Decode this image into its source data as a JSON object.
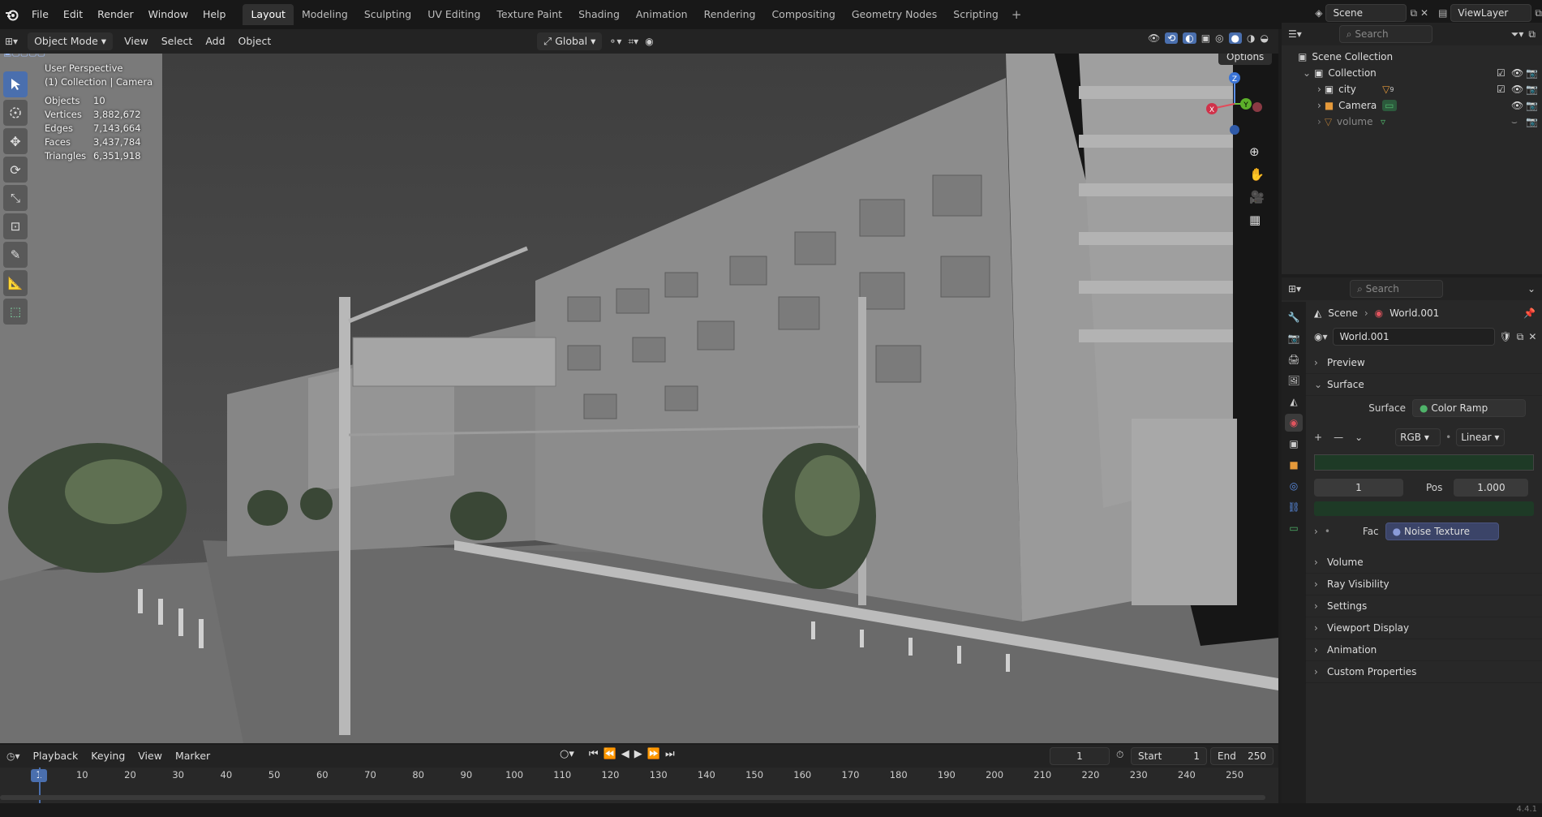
{
  "topbar": {
    "menus": [
      "File",
      "Edit",
      "Render",
      "Window",
      "Help"
    ],
    "workspaces": [
      "Layout",
      "Modeling",
      "Sculpting",
      "UV Editing",
      "Texture Paint",
      "Shading",
      "Animation",
      "Rendering",
      "Compositing",
      "Geometry Nodes",
      "Scripting"
    ],
    "active_workspace": "Layout",
    "scene": "Scene",
    "view_layer": "ViewLayer"
  },
  "viewport_header": {
    "mode": "Object Mode",
    "menus": [
      "View",
      "Select",
      "Add",
      "Object"
    ],
    "transform_orientation": "Global",
    "options": "Options"
  },
  "viewport": {
    "perspective": "User Perspective",
    "collection_info": "(1) Collection | Camera",
    "stats": [
      {
        "label": "Objects",
        "value": "10"
      },
      {
        "label": "Vertices",
        "value": "3,882,672"
      },
      {
        "label": "Edges",
        "value": "7,143,664"
      },
      {
        "label": "Faces",
        "value": "3,437,784"
      },
      {
        "label": "Triangles",
        "value": "6,351,918"
      }
    ],
    "gizmo": {
      "x": "X",
      "y": "Y",
      "z": "Z"
    }
  },
  "outliner": {
    "search_placeholder": "Search",
    "root": "Scene Collection",
    "items": [
      {
        "name": "Collection",
        "level": 0
      },
      {
        "name": "city",
        "level": 1
      },
      {
        "name": "Camera",
        "level": 1
      },
      {
        "name": "volume",
        "level": 1
      }
    ],
    "city_badge": "9"
  },
  "properties": {
    "search_placeholder": "Search",
    "breadcrumb": [
      "Scene",
      "World.001"
    ],
    "world_name": "World.001",
    "panels_top": [
      "Preview",
      "Surface"
    ],
    "surface_label": "Surface",
    "surface_value": "Color Ramp",
    "ramp_color_mode": "RGB",
    "ramp_interp": "Linear",
    "stop_index": "1",
    "pos_label": "Pos",
    "pos_value": "1.000",
    "fac_label": "Fac",
    "fac_value": "Noise Texture",
    "panels_bottom": [
      "Volume",
      "Ray Visibility",
      "Settings",
      "Viewport Display",
      "Animation",
      "Custom Properties"
    ]
  },
  "timeline": {
    "menus": [
      "Playback",
      "Keying",
      "View",
      "Marker"
    ],
    "current_frame": "1",
    "start_label": "Start",
    "start": "1",
    "end_label": "End",
    "end": "250",
    "ticks": [
      "1",
      "10",
      "20",
      "30",
      "40",
      "50",
      "60",
      "70",
      "80",
      "90",
      "100",
      "110",
      "120",
      "130",
      "140",
      "150",
      "160",
      "170",
      "180",
      "190",
      "200",
      "210",
      "220",
      "230",
      "240",
      "250"
    ]
  },
  "status": {
    "version": "4.4.1"
  },
  "colors": {
    "accent": "#4a6fae",
    "ramp_green": "#1e3a26",
    "noise_dot": "#6b7fb8",
    "surface_dot": "#4fb36a"
  }
}
